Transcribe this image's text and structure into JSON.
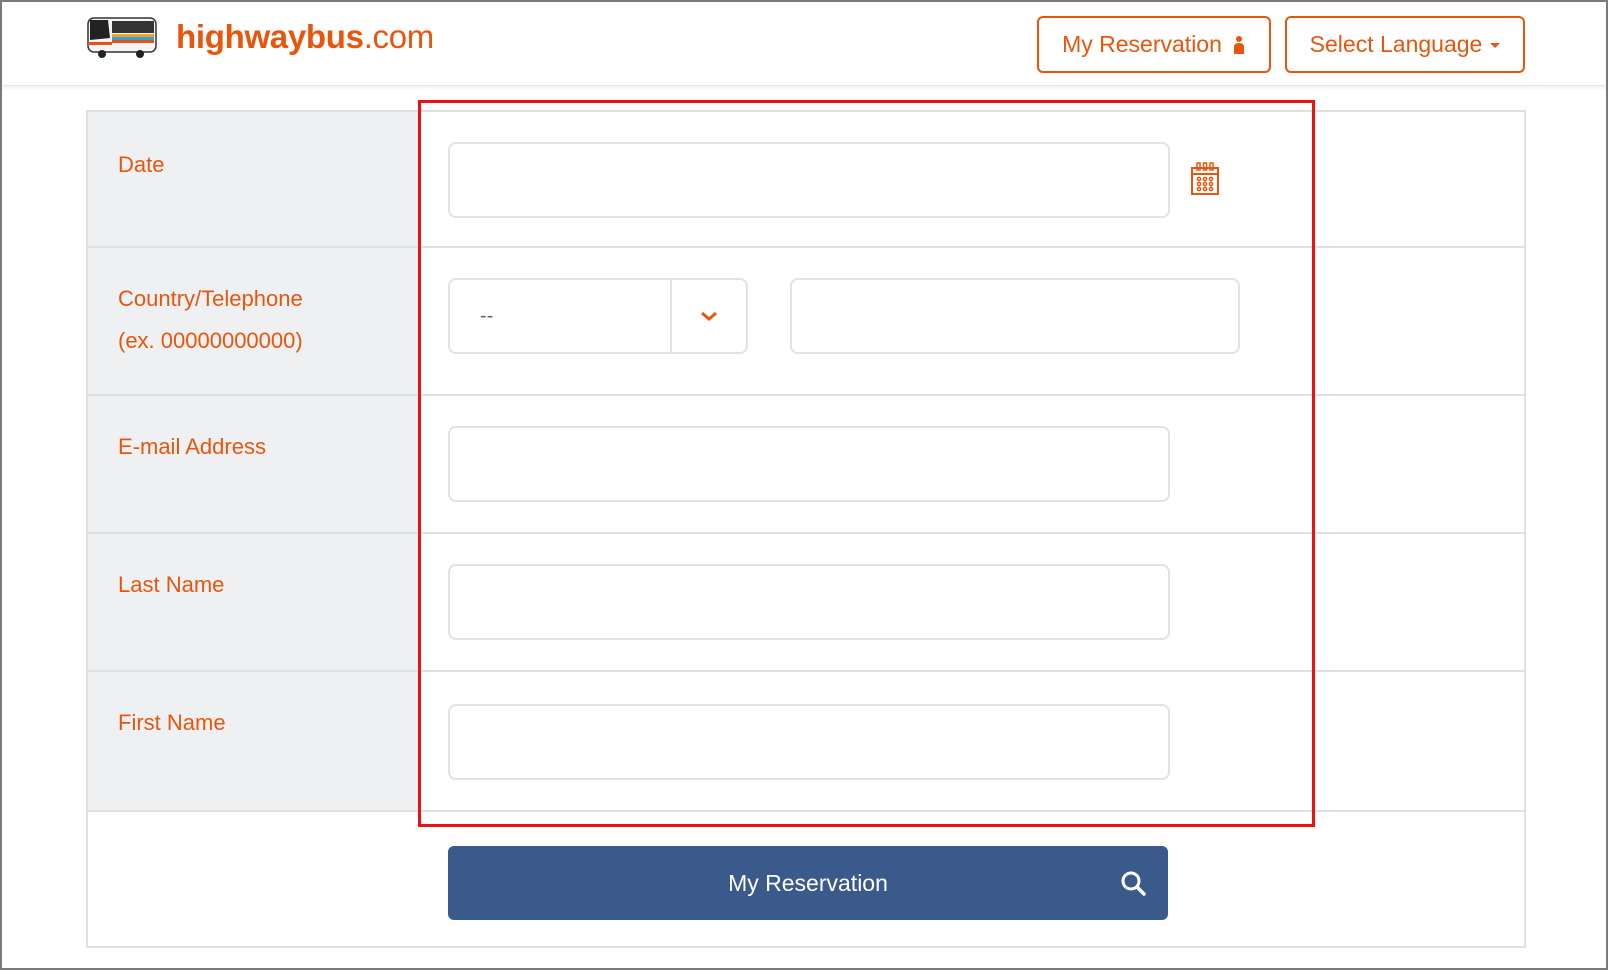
{
  "header": {
    "logo_bold": "highwaybus",
    "logo_suffix": ".com",
    "logo_icon": "bus-icon",
    "my_reservation_label": "My Reservation",
    "my_reservation_icon": "person-icon",
    "select_language_label": "Select Language",
    "select_language_icon": "caret-down-icon"
  },
  "form": {
    "rows": [
      {
        "label": "Date",
        "value": "",
        "icon": "calendar-icon"
      },
      {
        "label_line1": "Country/Telephone",
        "label_line2": "(ex. 00000000000)",
        "country_value": "--",
        "country_icon": "chevron-down-icon",
        "phone_value": ""
      },
      {
        "label": "E-mail Address",
        "value": ""
      },
      {
        "label": "Last Name",
        "value": ""
      },
      {
        "label": "First Name",
        "value": ""
      }
    ],
    "submit_label": "My Reservation",
    "submit_icon": "search-icon"
  },
  "colors": {
    "accent": "#e8560d",
    "button": "#3a5a8c",
    "label_bg": "#eff0f2",
    "highlight": "#ee1111"
  }
}
